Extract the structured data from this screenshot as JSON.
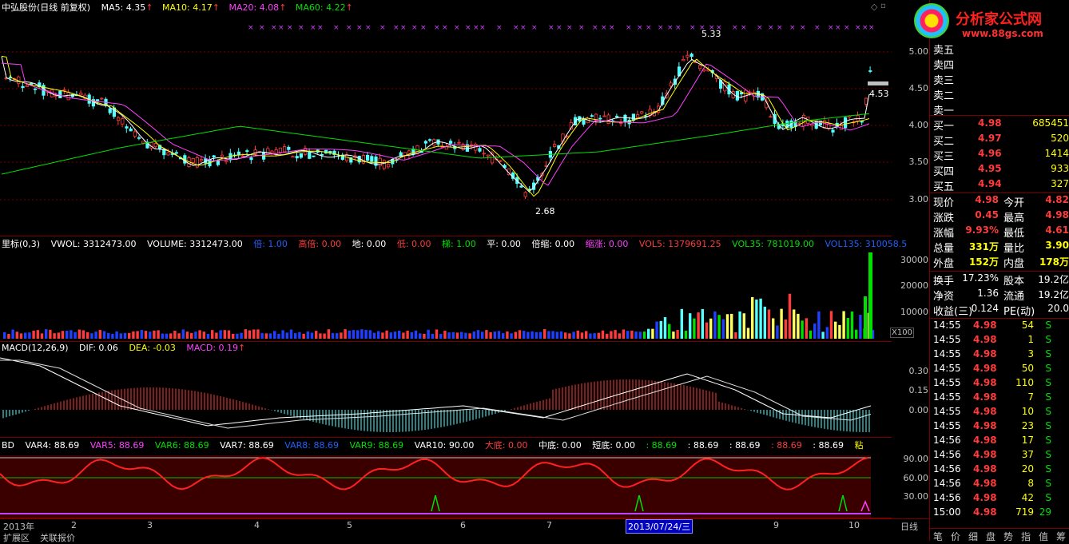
{
  "main": {
    "header": {
      "title": "中弘股份(日线 前复权)",
      "ma5": "MA5: 4.35",
      "ma10": "MA10: 4.17",
      "ma20": "MA20: 4.08",
      "ma60": "MA60: 4.22"
    },
    "y_ticks": [
      "5.00",
      "4.50",
      "4.00",
      "3.50",
      "3.00"
    ],
    "annotations": {
      "high": "5.33",
      "low": "2.68",
      "last": "4.53"
    }
  },
  "volume": {
    "header": {
      "a": "里标(0,3)",
      "vwol": "VWOL: 3312473.00",
      "volume": "VOLUME: 3312473.00",
      "bei": "倍: 1.00",
      "gaobei": "高倍: 0.00",
      "di": "地: 0.00",
      "low": "低: 0.00",
      "ti": "梯: 1.00",
      "ping": "平: 0.00",
      "beisuo": "倍缩: 0.00",
      "suozhang": "缩涨: 0.00",
      "vol5": "VOL5: 1379691.25",
      "vol35": "VOL35: 781019.00",
      "vol135": "VOL135: 310058.5"
    },
    "y_ticks": [
      "30000",
      "20000",
      "10000"
    ],
    "unit": "X100"
  },
  "macd": {
    "header": {
      "title": "MACD(12,26,9)",
      "dif": "DIF: 0.06",
      "dea": "DEA: -0.03",
      "macd": "MACD: 0.19"
    },
    "y_ticks": [
      "0.30",
      "0.15",
      "0.00"
    ]
  },
  "bd": {
    "header": {
      "title": "BD",
      "var4": "VAR4: 88.69",
      "var5": "VAR5: 88.69",
      "var6": "VAR6: 88.69",
      "var7": "VAR7: 88.69",
      "var8": "VAR8: 88.69",
      "var9": "VAR9: 88.69",
      "var10": "VAR10: 90.00",
      "dadi": "大底: 0.00",
      "zhongdi": "中底: 0.00",
      "duandi": "短底: 0.00",
      "e1": ": 88.69",
      "e2": ": 88.69",
      "e3": ": 88.69",
      "e4": ": 88.69",
      "e5": ": 88.69",
      "tail": "粘"
    },
    "y_ticks": [
      "90.00",
      "60.00",
      "30.00"
    ]
  },
  "time_axis": {
    "labels": [
      "2013年",
      "2",
      "3",
      "4",
      "5",
      "6",
      "7",
      "8",
      "9",
      "10"
    ],
    "cursor": "2013/07/24/三",
    "period": "日线"
  },
  "bottom_tabs": [
    "扩展区",
    "关联报价"
  ],
  "right_tabs": [
    "笔",
    "价",
    "细",
    "盘",
    "势",
    "指",
    "值",
    "筹"
  ],
  "logo": {
    "main": "分析家公式网",
    "url": "www.88gs.com"
  },
  "quote": {
    "asks": [
      {
        "label": "卖五",
        "price": "",
        "vol": ""
      },
      {
        "label": "卖四",
        "price": "",
        "vol": ""
      },
      {
        "label": "卖三",
        "price": "",
        "vol": ""
      },
      {
        "label": "卖二",
        "price": "",
        "vol": ""
      },
      {
        "label": "卖一",
        "price": "",
        "vol": ""
      }
    ],
    "bids": [
      {
        "label": "买一",
        "price": "4.98",
        "vol": "685451"
      },
      {
        "label": "买二",
        "price": "4.97",
        "vol": "520"
      },
      {
        "label": "买三",
        "price": "4.96",
        "vol": "1414"
      },
      {
        "label": "买四",
        "price": "4.95",
        "vol": "933"
      },
      {
        "label": "买五",
        "price": "4.94",
        "vol": "327"
      }
    ],
    "stats": [
      {
        "l1": "现价",
        "v1": "4.98",
        "l2": "今开",
        "v2": "4.82"
      },
      {
        "l1": "涨跌",
        "v1": "0.45",
        "l2": "最高",
        "v2": "4.98"
      },
      {
        "l1": "涨幅",
        "v1": "9.93%",
        "l2": "最低",
        "v2": "4.61"
      },
      {
        "l1": "总量",
        "v1": "331万",
        "l2": "量比",
        "v2": "3.90"
      },
      {
        "l1": "外盘",
        "v1": "152万",
        "l2": "内盘",
        "v2": "178万"
      }
    ],
    "fund": [
      {
        "l1": "换手",
        "v1": "17.23%",
        "l2": "股本",
        "v2": "19.2亿"
      },
      {
        "l1": "净资",
        "v1": "1.36",
        "l2": "流通",
        "v2": "19.2亿"
      },
      {
        "l1": "收益(三)",
        "v1": "0.124",
        "l2": "PE(动)",
        "v2": "20.0"
      }
    ],
    "ticks": [
      {
        "t": "14:55",
        "p": "4.98",
        "v": "54",
        "s": "S"
      },
      {
        "t": "14:55",
        "p": "4.98",
        "v": "1",
        "s": "S"
      },
      {
        "t": "14:55",
        "p": "4.98",
        "v": "3",
        "s": "S"
      },
      {
        "t": "14:55",
        "p": "4.98",
        "v": "50",
        "s": "S"
      },
      {
        "t": "14:55",
        "p": "4.98",
        "v": "110",
        "s": "S"
      },
      {
        "t": "14:55",
        "p": "4.98",
        "v": "7",
        "s": "S"
      },
      {
        "t": "14:55",
        "p": "4.98",
        "v": "10",
        "s": "S"
      },
      {
        "t": "14:55",
        "p": "4.98",
        "v": "23",
        "s": "S"
      },
      {
        "t": "14:56",
        "p": "4.98",
        "v": "17",
        "s": "S"
      },
      {
        "t": "14:56",
        "p": "4.98",
        "v": "37",
        "s": "S"
      },
      {
        "t": "14:56",
        "p": "4.98",
        "v": "20",
        "s": "S"
      },
      {
        "t": "14:56",
        "p": "4.98",
        "v": "8",
        "s": "S"
      },
      {
        "t": "14:56",
        "p": "4.98",
        "v": "42",
        "s": "S"
      },
      {
        "t": "15:00",
        "p": "4.98",
        "v": "719",
        "s": "29"
      }
    ]
  }
}
